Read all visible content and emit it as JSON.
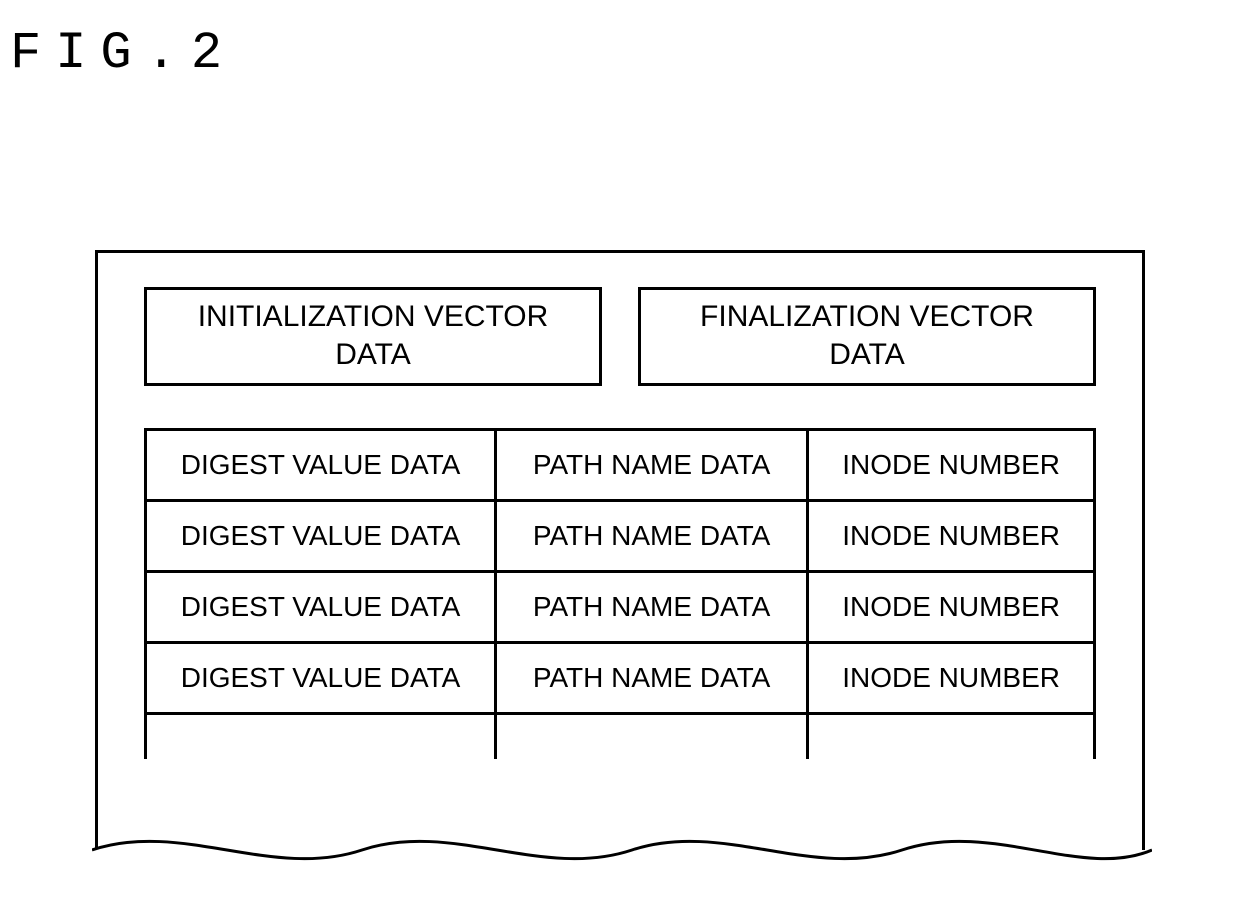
{
  "figure_label": "FIG.2",
  "header_boxes": {
    "left": "INITIALIZATION VECTOR\nDATA",
    "right": "FINALIZATION VECTOR\nDATA"
  },
  "table": {
    "columns": [
      "DIGEST VALUE DATA",
      "PATH NAME DATA",
      "INODE NUMBER"
    ],
    "rows": [
      [
        "DIGEST VALUE DATA",
        "PATH NAME DATA",
        "INODE NUMBER"
      ],
      [
        "DIGEST VALUE DATA",
        "PATH NAME DATA",
        "INODE NUMBER"
      ],
      [
        "DIGEST VALUE DATA",
        "PATH NAME DATA",
        "INODE NUMBER"
      ],
      [
        "DIGEST VALUE DATA",
        "PATH NAME DATA",
        "INODE NUMBER"
      ]
    ],
    "continuation": true
  }
}
